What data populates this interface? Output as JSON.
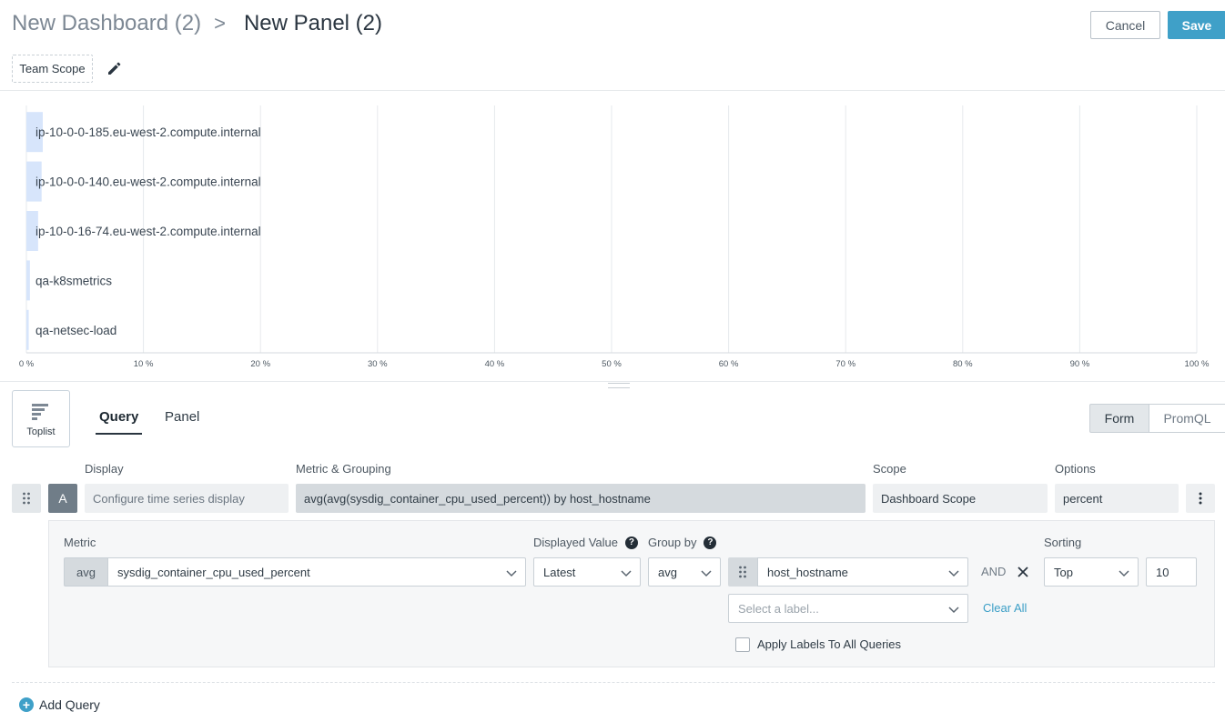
{
  "header": {
    "breadcrumb_parent": "New Dashboard (2)",
    "breadcrumb_separator": ">",
    "title": "New Panel (2)",
    "cancel_label": "Cancel",
    "save_label": "Save",
    "scope_chip": "Team Scope"
  },
  "chart_data": {
    "type": "bar",
    "orientation": "horizontal",
    "categories": [
      "ip-10-0-0-185.eu-west-2.compute.internal",
      "ip-10-0-0-140.eu-west-2.compute.internal",
      "ip-10-0-16-74.eu-west-2.compute.internal",
      "qa-k8smetrics",
      "qa-netsec-load"
    ],
    "values": [
      1.4,
      1.3,
      1.0,
      0.3,
      0.2
    ],
    "xlim": [
      0,
      100
    ],
    "x_ticks": [
      "0 %",
      "10 %",
      "20 %",
      "30 %",
      "40 %",
      "50 %",
      "60 %",
      "70 %",
      "80 %",
      "90 %",
      "100 %"
    ],
    "grid": true,
    "bar_color": "#d7e5fb"
  },
  "viz": {
    "label": "Toplist"
  },
  "tabs": {
    "query": "Query",
    "panel": "Panel"
  },
  "mode": {
    "form": "Form",
    "promql": "PromQL"
  },
  "query": {
    "letter": "A",
    "display_label": "Display",
    "display_placeholder": "Configure time series display",
    "metric_grouping_label": "Metric & Grouping",
    "metric_grouping_value": "avg(avg(sysdig_container_cpu_used_percent)) by host_hostname",
    "scope_label": "Scope",
    "scope_value": "Dashboard Scope",
    "options_label": "Options",
    "options_value": "percent"
  },
  "builder": {
    "metric_label": "Metric",
    "metric_agg": "avg",
    "metric_value": "sysdig_container_cpu_used_percent",
    "displayed_value_label": "Displayed Value",
    "displayed_value": "Latest",
    "group_by_label": "Group by",
    "group_by_agg": "avg",
    "group_by_label_value": "host_hostname",
    "and_label": "AND",
    "label_placeholder": "Select a label...",
    "clear_all": "Clear All",
    "apply_labels": "Apply Labels To All Queries",
    "apply_labels_checked": false,
    "sorting_label": "Sorting",
    "sorting_value": "Top",
    "limit_value": "10"
  },
  "footer": {
    "add_query": "Add Query"
  },
  "icons": {
    "edit": "pencil-icon",
    "toplist": "toplist-icon",
    "help": "question-icon",
    "drag": "drag-handle-icon",
    "more": "kebab-icon",
    "remove": "close-icon",
    "add": "plus-circle-icon"
  }
}
